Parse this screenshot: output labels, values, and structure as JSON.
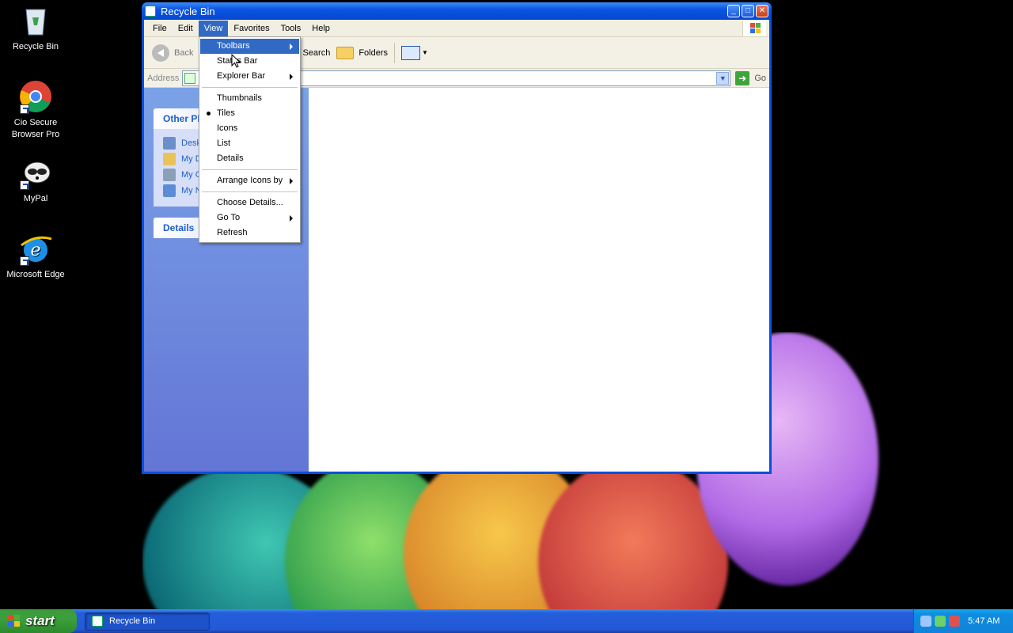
{
  "desktop": {
    "icons": [
      {
        "label": "Recycle Bin"
      },
      {
        "label": "Cio Secure\nBrowser Pro"
      },
      {
        "label": "MyPal"
      },
      {
        "label": "Microsoft Edge"
      }
    ]
  },
  "window": {
    "title": "Recycle Bin",
    "menubar": [
      "File",
      "Edit",
      "View",
      "Favorites",
      "Tools",
      "Help"
    ],
    "active_menu": "View",
    "toolbar": {
      "back": "Back",
      "search": "Search",
      "folders": "Folders"
    },
    "address": {
      "label": "Address",
      "go": "Go"
    },
    "taskpane": {
      "other_places_title": "Other Pl",
      "links": [
        "Desk",
        "My D",
        "My C",
        "My N"
      ],
      "details_title": "Details"
    }
  },
  "view_menu": {
    "items": [
      {
        "label": "Toolbars",
        "submenu": true,
        "highlighted": true
      },
      {
        "label": "Status Bar"
      },
      {
        "label": "Explorer Bar",
        "submenu": true
      },
      {
        "separator": true
      },
      {
        "label": "Thumbnails"
      },
      {
        "label": "Tiles",
        "selected": true
      },
      {
        "label": "Icons"
      },
      {
        "label": "List"
      },
      {
        "label": "Details"
      },
      {
        "separator": true
      },
      {
        "label": "Arrange Icons by",
        "submenu": true
      },
      {
        "separator": true
      },
      {
        "label": "Choose Details..."
      },
      {
        "label": "Go To",
        "submenu": true
      },
      {
        "label": "Refresh"
      }
    ]
  },
  "taskbar": {
    "start_label": "start",
    "tasks": [
      "Recycle Bin"
    ],
    "clock": "5:47 AM"
  },
  "colors": {
    "xp_blue": "#0a4fdd",
    "menu_highlight": "#316ac5",
    "start_green": "#3ba03b"
  }
}
